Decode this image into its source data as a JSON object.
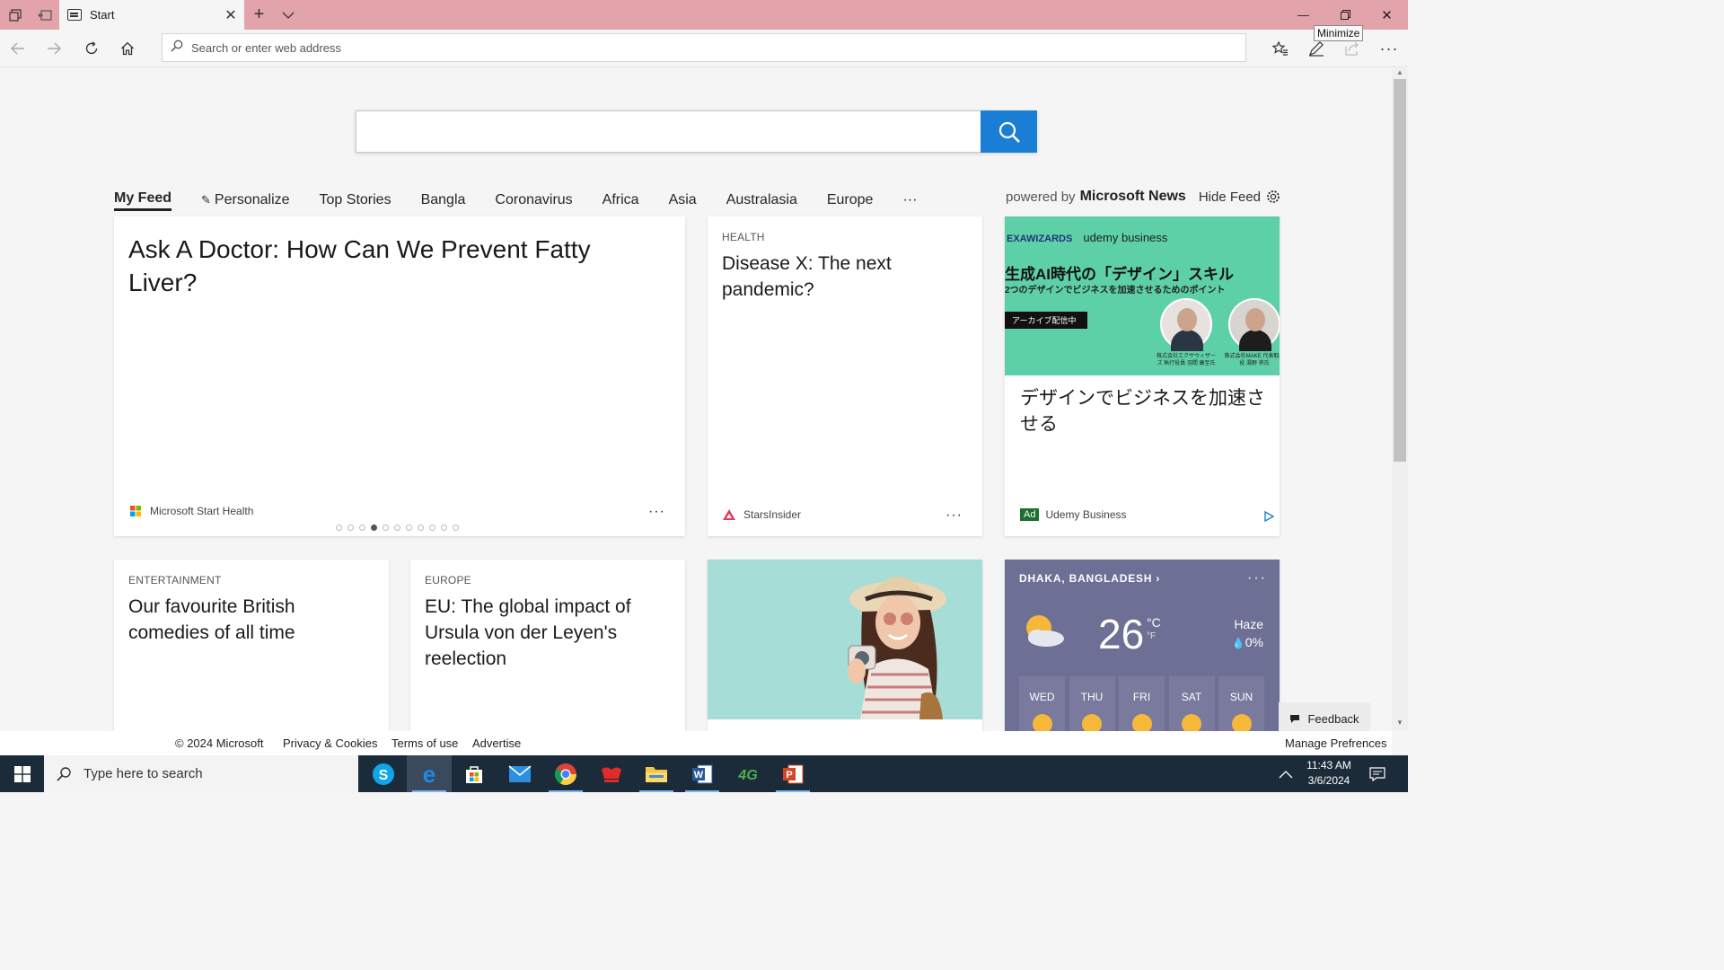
{
  "browser": {
    "tab_title": "Start",
    "tooltip": "Minimize",
    "address_placeholder": "Search or enter web address"
  },
  "feed_nav": {
    "items": [
      "My Feed",
      "Personalize",
      "Top Stories",
      "Bangla",
      "Coronavirus",
      "Africa",
      "Asia",
      "Australasia",
      "Europe"
    ],
    "overflow": "···",
    "powered_by": "powered by",
    "brand": "Microsoft News",
    "hide_feed": "Hide Feed"
  },
  "cards": {
    "hero": {
      "headline": "Ask A Doctor: How Can We Prevent Fatty Liver?",
      "source": "Microsoft Start Health",
      "more": "···",
      "slides": 11,
      "active_slide": 3
    },
    "health": {
      "category": "HEALTH",
      "headline": "Disease X: The next pandemic?",
      "source": "StarsInsider",
      "more": "···"
    },
    "ad": {
      "logo_left": "EXAWIZARDS",
      "logo_right": "udemy business",
      "banner_title": "生成AI時代の「デザイン」スキル",
      "banner_subtitle": "2つのデザインでビジネスを加速させるためのポイント",
      "banner_tag": "アーカイブ配信中",
      "person1_caption": "株式会社エクサウィザーズ 執行役員 羽間 康至氏",
      "person2_caption": "株式会社MAKE 代表取締役 湯野 将氏",
      "headline": "デザインでビジネスを加速させる",
      "badge": "Ad",
      "source": "Udemy Business"
    },
    "entertainment": {
      "category": "ENTERTAINMENT",
      "headline": "Our favourite British comedies of all time"
    },
    "europe": {
      "category": "EUROPE",
      "headline": "EU: The global impact of Ursula von der Leyen's reelection"
    }
  },
  "weather": {
    "location": "DHAKA, BANGLADESH",
    "more": "···",
    "temperature": "26",
    "unit_c": "°C",
    "unit_f": "°F",
    "condition": "Haze",
    "precip": "0%",
    "days": [
      "WED",
      "THU",
      "FRI",
      "SAT",
      "SUN"
    ]
  },
  "feedback": "Feedback",
  "footer": {
    "copyright": "© 2024 Microsoft",
    "privacy": "Privacy & Cookies",
    "terms": "Terms of use",
    "advertise": "Advertise",
    "manage": "Manage Prefrences"
  },
  "taskbar": {
    "search_placeholder": "Type here to search",
    "time": "11:43 AM",
    "date": "3/6/2024",
    "apps": [
      "skype-icon",
      "edge-icon",
      "store-icon",
      "mail-icon",
      "chrome-icon",
      "bangla-app-icon",
      "file-explorer-icon",
      "word-icon",
      "4g-icon",
      "powerpoint-icon"
    ]
  },
  "colors": {
    "titlebar": "#e3a3aa",
    "search_button": "#1a7fd4",
    "ad_banner": "#5ed0a8",
    "weather_card": "#6e6f95",
    "taskbar": "#1c2b3a"
  }
}
